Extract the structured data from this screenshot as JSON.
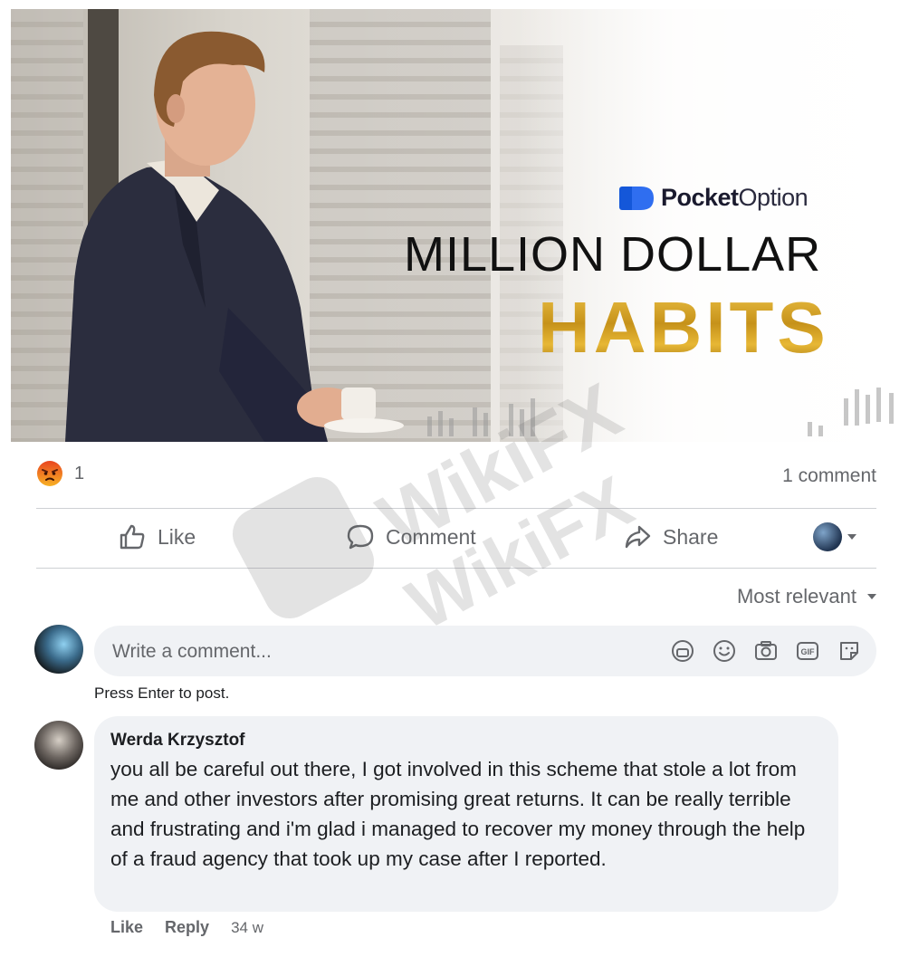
{
  "banner": {
    "brand_bold": "Pocket",
    "brand_light": "Option",
    "headline_line1": "MILLION DOLLAR",
    "headline_line2": "HABITS"
  },
  "reactions": {
    "icon": "angry-reaction-icon",
    "count": "1",
    "comments": "1 comment"
  },
  "actions": {
    "like": "Like",
    "comment": "Comment",
    "share": "Share"
  },
  "sort": {
    "label": "Most relevant"
  },
  "composer": {
    "placeholder": "Write a comment...",
    "hint": "Press Enter to post.",
    "icons": [
      "avatar-sticker-icon",
      "emoji-icon",
      "camera-icon",
      "gif-icon",
      "sticker-icon"
    ]
  },
  "comment": {
    "author": "Werda Krzysztof",
    "text": "you all be careful out there, I got involved in this scheme that stole a lot from me and other investors after promising great returns. It can be really terrible and frustrating and i'm glad i managed to recover my money through the help of a fraud agency that took up my case after I reported.",
    "like": "Like",
    "reply": "Reply",
    "time": "34 w"
  },
  "watermark": {
    "text": "WikiFX"
  },
  "colors": {
    "secondary_text": "#65676b",
    "bubble_bg": "#f0f2f5",
    "brand_blue": "#1457d9",
    "gold": "#c99a17"
  }
}
